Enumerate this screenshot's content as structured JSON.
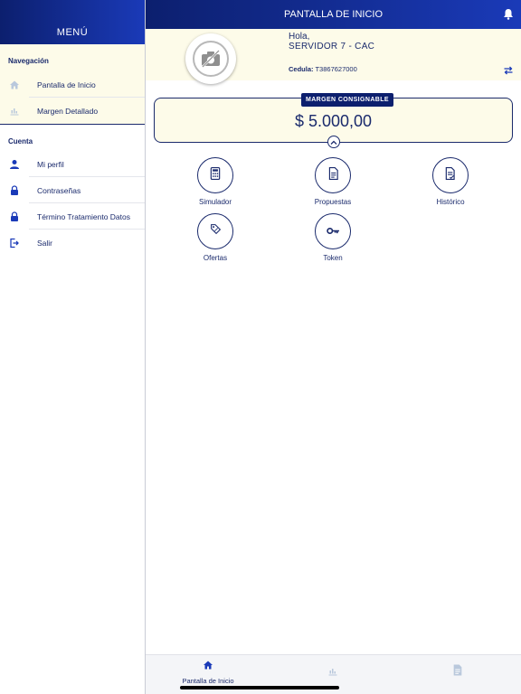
{
  "sidebar": {
    "title": "MENÚ",
    "navigation": {
      "title": "Navegación",
      "items": [
        {
          "label": "Pantalla de Inicio",
          "icon": "home-icon"
        },
        {
          "label": "Margen Detallado",
          "icon": "bar-chart-icon"
        }
      ]
    },
    "account": {
      "title": "Cuenta",
      "items": [
        {
          "label": "Mi perfil",
          "icon": "user-icon"
        },
        {
          "label": "Contraseñas",
          "icon": "lock-icon"
        },
        {
          "label": "Término Tratamiento Datos",
          "icon": "lock-icon"
        },
        {
          "label": "Salir",
          "icon": "logout-icon"
        }
      ]
    }
  },
  "header": {
    "title": "PANTALLA DE INICIO",
    "bell_icon": "bell-icon"
  },
  "profile": {
    "greeting": "Hola,",
    "name": "SERVIDOR 7 - CAC",
    "cedula_label": "Cedula:",
    "cedula_value": "T3867627000",
    "avatar_icon": "no-photo-icon",
    "swap_icon": "swap-arrows-icon"
  },
  "margin": {
    "label": "MARGEN CONSIGNABLE",
    "amount": "$ 5.000,00",
    "collapse_icon": "chevron-up-icon"
  },
  "actions": [
    {
      "label": "Simulador",
      "icon": "calculator-icon"
    },
    {
      "label": "Propuestas",
      "icon": "document-icon"
    },
    {
      "label": "Histórico",
      "icon": "document-check-icon"
    },
    {
      "label": "Ofertas",
      "icon": "tag-icon"
    },
    {
      "label": "Token",
      "icon": "key-icon"
    }
  ],
  "tabbar": {
    "tabs": [
      {
        "label": "Pantalla de Inicio",
        "icon": "home-icon",
        "active": true
      },
      {
        "label": "",
        "icon": "bar-chart-icon",
        "active": false
      },
      {
        "label": "",
        "icon": "document-icon",
        "active": false
      }
    ]
  },
  "colors": {
    "primary": "#1a2a6c",
    "header_dark": "#0c1f6e",
    "header_light": "#1a3ab8",
    "cream": "#fdfbe9",
    "inactive_icon": "#b9c2cf"
  }
}
